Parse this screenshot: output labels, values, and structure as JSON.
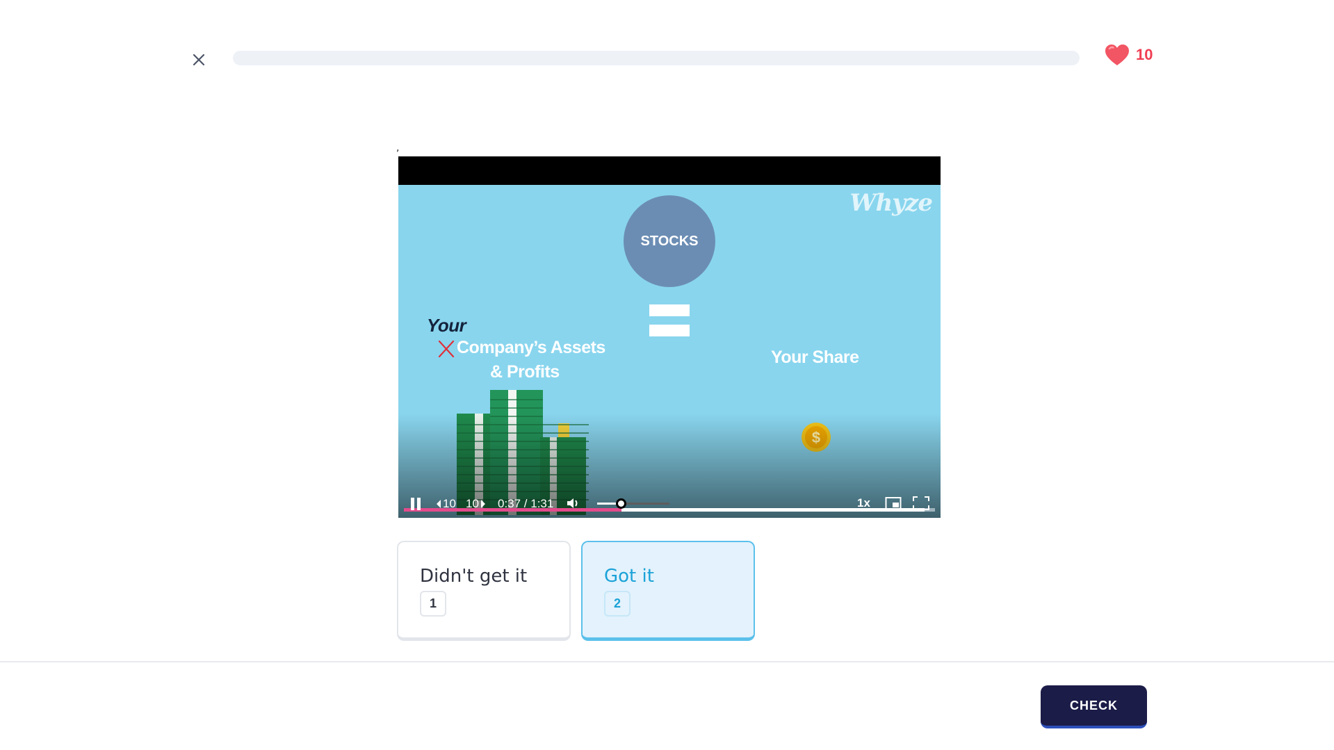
{
  "header": {
    "close_icon": "close-icon",
    "progress_fraction": 0.0,
    "hearts_icon": "heart-icon",
    "hearts_count": "10",
    "heart_color": "#f03e52"
  },
  "stray_mark": ",",
  "video": {
    "watermark": "Whyze",
    "circle_label": "STOCKS",
    "your_label": "Your",
    "assets_label": "Company’s Assets",
    "profits_label": "& Profits",
    "share_label": "Your Share",
    "time_display": "0:37 / 1:31",
    "played_fraction": 0.41,
    "buffered_fraction": 0.98,
    "volume_fraction": 0.33,
    "rewind_label": "10",
    "forward_label": "10",
    "speed_label": "1x",
    "played_color": "#e34b8c",
    "stage_color": "#89d5ee",
    "circle_color": "#6b8db4"
  },
  "choices": [
    {
      "label": "Didn't get it",
      "key": "1"
    },
    {
      "label": "Got it",
      "key": "2"
    }
  ],
  "footer": {
    "check_label": "CHECK",
    "check_color": "#1b1c47"
  }
}
